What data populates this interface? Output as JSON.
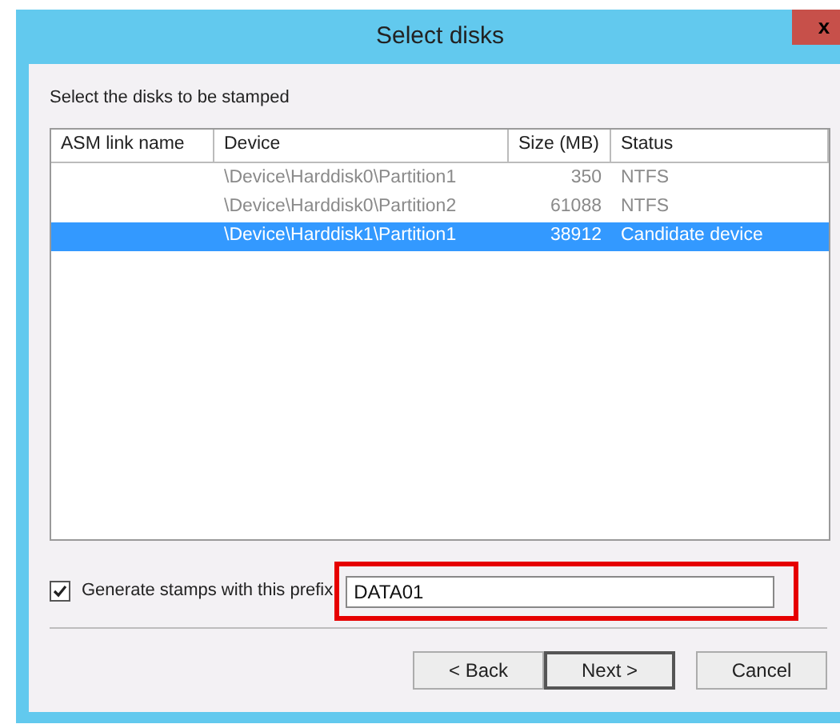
{
  "window": {
    "title": "Select disks",
    "close": "x"
  },
  "instruction": "Select the disks to be stamped",
  "table": {
    "columns": [
      "ASM link name",
      "Device",
      "Size (MB)",
      "Status"
    ],
    "rows": [
      {
        "asm_link_name": "",
        "device": "\\Device\\Harddisk0\\Partition1",
        "size": "350",
        "status": "NTFS",
        "selected": false
      },
      {
        "asm_link_name": "",
        "device": "\\Device\\Harddisk0\\Partition2",
        "size": "61088",
        "status": "NTFS",
        "selected": false
      },
      {
        "asm_link_name": "",
        "device": "\\Device\\Harddisk1\\Partition1",
        "size": "38912",
        "status": "Candidate device",
        "selected": true
      }
    ]
  },
  "prefix": {
    "label": "Generate stamps with this prefix",
    "checked": true,
    "value": "DATA01",
    "highlighted": true
  },
  "buttons": [
    {
      "label": "< Back",
      "default": false
    },
    {
      "label": "Next >",
      "default": true
    },
    {
      "label": "Cancel",
      "default": false
    }
  ]
}
